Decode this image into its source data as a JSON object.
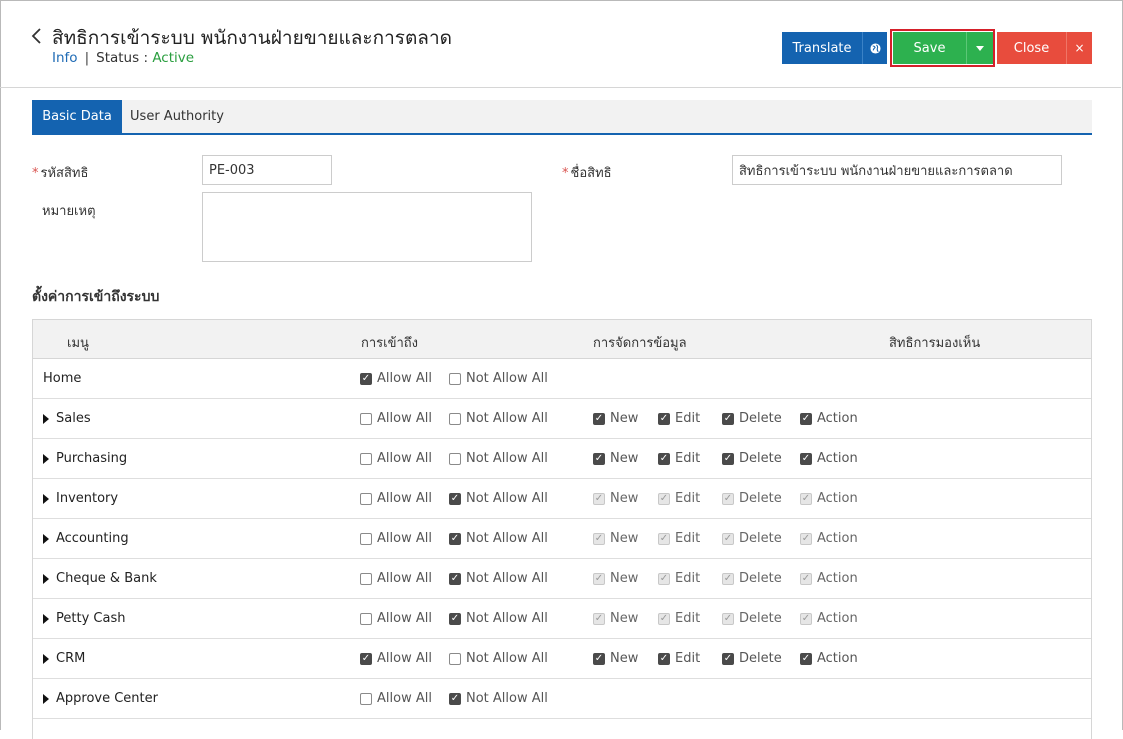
{
  "header": {
    "title": "สิทธิการเข้าระบบ พนักงานฝ่ายขายและการตลาด",
    "info_link": "Info",
    "separator": "|",
    "status_label": "Status",
    "status_colon": ":",
    "status_value": "Active"
  },
  "toolbar": {
    "translate_label": "Translate",
    "save_label": "Save",
    "close_label": "Close",
    "close_x": "×"
  },
  "tabs": [
    {
      "label": "Basic Data",
      "active": true
    },
    {
      "label": "User Authority",
      "active": false
    }
  ],
  "form": {
    "req_mark": "*",
    "code_label": "รหัสสิทธิ",
    "code_value": "PE-003",
    "name_label": "ชื่อสิทธิ",
    "name_value": "สิทธิการเข้าระบบ พนักงานฝ่ายขายและการตลาด",
    "note_label": "หมายเหตุ",
    "note_value": ""
  },
  "access_section_title": "ตั้งค่าการเข้าถึงระบบ",
  "table": {
    "headers": [
      "เมนู",
      "การเข้าถึง",
      "การจัดการข้อมูล",
      "สิทธิการมองเห็น"
    ],
    "labels": {
      "allow_all": "Allow All",
      "not_allow_all": "Not Allow All",
      "new": "New",
      "edit": "Edit",
      "delete": "Delete",
      "action": "Action"
    },
    "rows": [
      {
        "menu": "Home",
        "expandable": false,
        "allow_all": true,
        "not_allow_all": false,
        "data_mgmt": null
      },
      {
        "menu": "Sales",
        "expandable": true,
        "allow_all": false,
        "not_allow_all": false,
        "data_mgmt": {
          "new": true,
          "edit": true,
          "delete": true,
          "action": true,
          "disabled": false
        }
      },
      {
        "menu": "Purchasing",
        "expandable": true,
        "allow_all": false,
        "not_allow_all": false,
        "data_mgmt": {
          "new": true,
          "edit": true,
          "delete": true,
          "action": true,
          "disabled": false
        }
      },
      {
        "menu": "Inventory",
        "expandable": true,
        "allow_all": false,
        "not_allow_all": true,
        "data_mgmt": {
          "new": true,
          "edit": true,
          "delete": true,
          "action": true,
          "disabled": true
        }
      },
      {
        "menu": "Accounting",
        "expandable": true,
        "allow_all": false,
        "not_allow_all": true,
        "data_mgmt": {
          "new": true,
          "edit": true,
          "delete": true,
          "action": true,
          "disabled": true
        }
      },
      {
        "menu": "Cheque & Bank",
        "expandable": true,
        "allow_all": false,
        "not_allow_all": true,
        "data_mgmt": {
          "new": true,
          "edit": true,
          "delete": true,
          "action": true,
          "disabled": true
        }
      },
      {
        "menu": "Petty Cash",
        "expandable": true,
        "allow_all": false,
        "not_allow_all": true,
        "data_mgmt": {
          "new": true,
          "edit": true,
          "delete": true,
          "action": true,
          "disabled": true
        }
      },
      {
        "menu": "CRM",
        "expandable": true,
        "allow_all": true,
        "not_allow_all": false,
        "data_mgmt": {
          "new": true,
          "edit": true,
          "delete": true,
          "action": true,
          "disabled": false
        }
      },
      {
        "menu": "Approve Center",
        "expandable": true,
        "allow_all": false,
        "not_allow_all": true,
        "data_mgmt": null
      }
    ]
  },
  "colors": {
    "primary": "#1463b0",
    "save": "#2db14f",
    "close": "#e84c3d",
    "active_status": "#2a9e3f",
    "highlight_border": "#d5202a"
  },
  "icons": {
    "back": "chevron-left-icon",
    "translate": "globe-icon",
    "save_menu": "caret-down-icon",
    "close": "close-icon",
    "row_expand": "caret-right-icon",
    "checkbox": "checkbox-icon"
  }
}
